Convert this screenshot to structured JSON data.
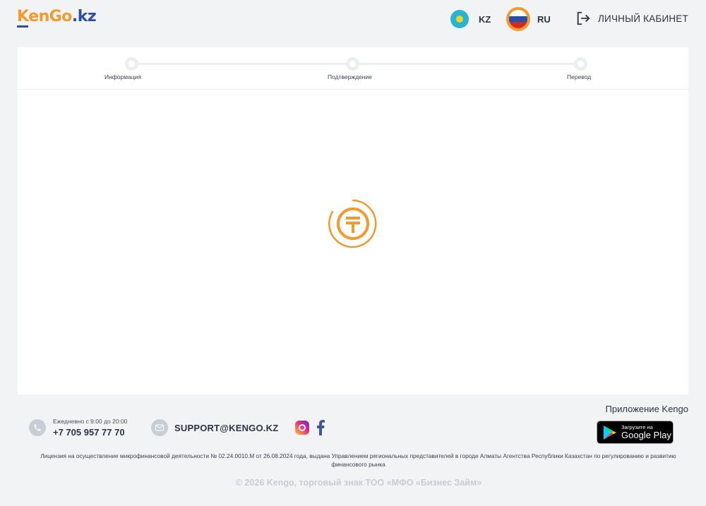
{
  "header": {
    "logo": {
      "part1": "Ken",
      "part2": "Go",
      "part3": ".kz"
    },
    "languages": [
      {
        "code": "KZ",
        "flag": "kazakhstan-flag-icon",
        "active": false
      },
      {
        "code": "RU",
        "flag": "russia-flag-icon",
        "active": true
      }
    ],
    "cabinet_label": "ЛИЧНЫЙ КАБИНЕТ"
  },
  "stepper": {
    "steps": [
      {
        "label": "Информация"
      },
      {
        "label": "Подтверждение"
      },
      {
        "label": "Перевод"
      }
    ]
  },
  "main": {
    "loader_icon": "tenge-coin-spinner-icon"
  },
  "footer": {
    "phone_hours": "Ежедневно с 9:00 до 20:00",
    "phone_number": "+7 705 957 77 70",
    "email": "SUPPORT@KENGO.KZ",
    "social": [
      "instagram-icon",
      "facebook-icon"
    ],
    "app_title": "Приложение Kengo",
    "google_play": {
      "small": "Загрузите на",
      "big": "Google Play"
    },
    "license": "Лицензия на осуществление микрофинансовой деятельности № 02.24.0010.М от 26.08.2024 года, выдана Управлением региональных представителей в городе Алматы Агентства Республики Казахстан по регулированию и развитию финансового рынка",
    "copyright": "© 2026 Kengo, торговый знак ТОО «МФО «Бизнес Займ»"
  },
  "colors": {
    "accent": "#f29a2e",
    "brand_blue": "#2d4fa3",
    "background": "#f1f3f5",
    "card": "#ffffff"
  }
}
